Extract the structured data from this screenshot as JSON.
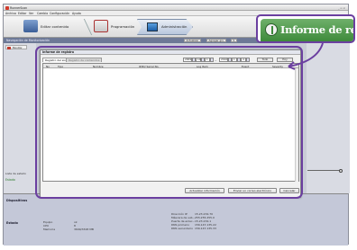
{
  "app": {
    "title": "RunnerScan",
    "window_buttons": "_ ▫ ×"
  },
  "menu": [
    "Archivo",
    "Editar",
    "Ver",
    "Cambio",
    "Configuración",
    "Ayuda"
  ],
  "wizard": {
    "steps": [
      {
        "label": "Editar contenido"
      },
      {
        "label": "Programación"
      },
      {
        "label": "Administración"
      }
    ]
  },
  "subtoolbar": {
    "left_label": "Navegación de Monitorización",
    "right_buttons": [
      "Actualizar",
      "Agregar gru",
      "S"
    ]
  },
  "left_panel": {
    "item_label": "Monitor",
    "state_label": "Lista de estado",
    "ok_label": "Estado"
  },
  "dialog": {
    "title": "Informe de registro",
    "tabs": [
      "Registro del sistema",
      "Registro de contenidos"
    ],
    "filter": {
      "from_year": "2009",
      "from_month": "10",
      "from_day": "1",
      "to_year": "2010",
      "to_month": "1",
      "to_day": "4",
      "search_button": "Todo",
      "more_button": "Hoy"
    },
    "columns": [
      "No",
      "Tipo",
      "Nombre",
      "IP/ID/ Serial No.",
      "Log Item",
      "Event",
      "Severity"
    ],
    "buttons": {
      "refresh": "Actualizar información",
      "send": "Enviar un correo electrónico",
      "cancel": "Cancelar"
    }
  },
  "bottom": {
    "section1": "Dispositivos",
    "section2": "Estado",
    "state_rows": [
      {
        "k": "Equipo",
        "v": "ok"
      },
      {
        "k": "CPU",
        "v": "8"
      },
      {
        "k": "Memoria",
        "v": "3699/3328 MB"
      }
    ],
    "network_rows": [
      {
        "k": "Dirección IP",
        "v": "15.23.234.70"
      },
      {
        "k": "Máscara de sub...",
        "v": "255.255.255.0"
      },
      {
        "k": "Puerta de enlac...",
        "v": "15.23.234.1"
      },
      {
        "k": "DNS primario",
        "v": "156.147.135.22"
      },
      {
        "k": "DNS secundario",
        "v": "156.147.135.33"
      }
    ]
  },
  "callout": {
    "label": "Informe de registro",
    "icon": "info-circle-icon",
    "accent": "#6b3fa0",
    "header_color": "#4f9a4c"
  }
}
